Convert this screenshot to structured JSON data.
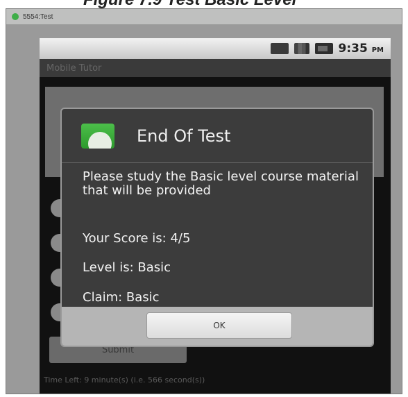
{
  "caption": "Figure 7.9 Test Basic Level",
  "emulator": {
    "title": "5554:Test"
  },
  "status_bar": {
    "time": "9:35",
    "ampm": "PM"
  },
  "app": {
    "title": "Mobile Tutor"
  },
  "dialog": {
    "title": "End Of Test",
    "message": "Please study the Basic level course material that will be provided",
    "score": "Your Score is: 4/5",
    "level": "Level is: Basic",
    "claim": "Claim: Basic",
    "ok_label": "OK"
  },
  "background": {
    "submit_label": "Submit",
    "time_left": "Time Left: 9 minute(s) (i.e. 566 second(s))"
  },
  "icons": [
    "app-icon",
    "signal-icon",
    "battery-icon",
    "data-icon"
  ]
}
